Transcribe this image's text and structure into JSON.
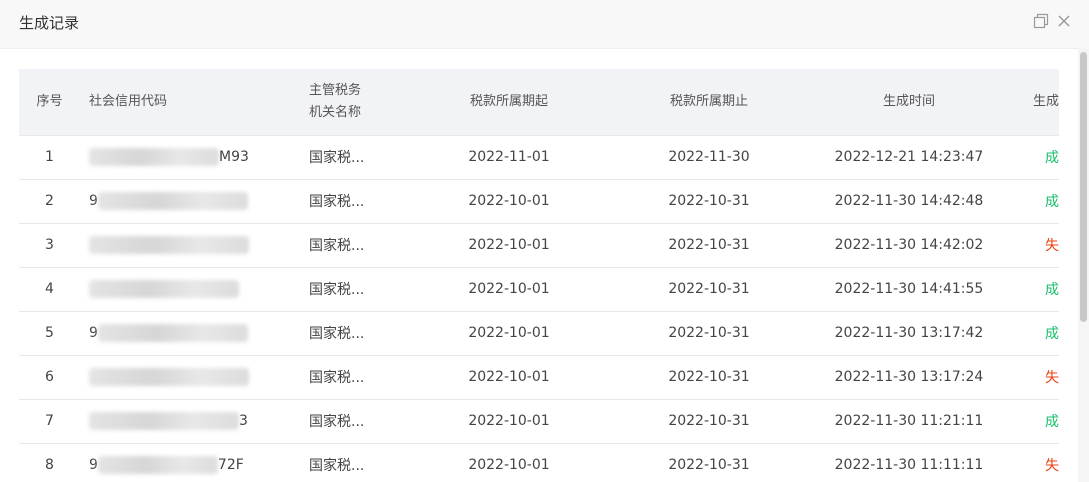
{
  "dialog": {
    "title": "生成记录"
  },
  "table": {
    "headers": {
      "index": "序号",
      "code": "社会信用代码",
      "authority_line1": "主管税务",
      "authority_line2": "机关名称",
      "period_start": "税款所属期起",
      "period_end": "税款所属期止",
      "gen_time": "生成时间",
      "result": "生成结果"
    },
    "rows": [
      {
        "index": "1",
        "code_prefix": "",
        "code_suffix": "M93",
        "authority": "国家税...",
        "start": "2022-11-01",
        "end": "2022-11-30",
        "time": "2022-12-21 14:23:47",
        "result": "成功",
        "status": "ok"
      },
      {
        "index": "2",
        "code_prefix": "9",
        "code_suffix": "",
        "authority": "国家税...",
        "start": "2022-10-01",
        "end": "2022-10-31",
        "time": "2022-11-30 14:42:48",
        "result": "成功",
        "status": "ok"
      },
      {
        "index": "3",
        "code_prefix": "",
        "code_suffix": "",
        "authority": "国家税...",
        "start": "2022-10-01",
        "end": "2022-10-31",
        "time": "2022-11-30 14:42:02",
        "result": "失败",
        "status": "fail"
      },
      {
        "index": "4",
        "code_prefix": "",
        "code_suffix": "",
        "authority": "国家税...",
        "start": "2022-10-01",
        "end": "2022-10-31",
        "time": "2022-11-30 14:41:55",
        "result": "成功",
        "status": "ok"
      },
      {
        "index": "5",
        "code_prefix": "9",
        "code_suffix": "",
        "authority": "国家税...",
        "start": "2022-10-01",
        "end": "2022-10-31",
        "time": "2022-11-30 13:17:42",
        "result": "成功",
        "status": "ok"
      },
      {
        "index": "6",
        "code_prefix": "",
        "code_suffix": "",
        "authority": "国家税...",
        "start": "2022-10-01",
        "end": "2022-10-31",
        "time": "2022-11-30 13:17:24",
        "result": "失败",
        "status": "fail"
      },
      {
        "index": "7",
        "code_prefix": "",
        "code_suffix": "3",
        "authority": "国家税...",
        "start": "2022-10-01",
        "end": "2022-10-31",
        "time": "2022-11-30 11:21:11",
        "result": "成功",
        "status": "ok"
      },
      {
        "index": "8",
        "code_prefix": "9",
        "code_suffix": "72F",
        "authority": "国家税...",
        "start": "2022-10-01",
        "end": "2022-10-31",
        "time": "2022-11-30 11:11:11",
        "result": "失败",
        "status": "fail"
      }
    ]
  },
  "colors": {
    "success": "#19be6b",
    "failure": "#ed4014",
    "header_bg": "#f2f3f7"
  },
  "icons": {
    "restore": "restore-icon",
    "close": "close-icon"
  }
}
